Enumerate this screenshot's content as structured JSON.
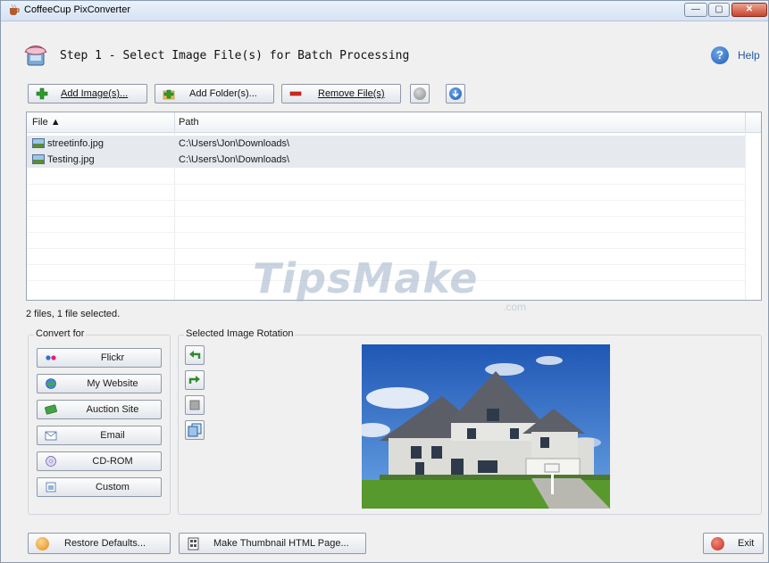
{
  "window": {
    "title": "CoffeeCup PixConverter",
    "min_glyph": "—",
    "max_glyph": "▢",
    "close_glyph": "✕"
  },
  "step": {
    "title": "Step 1 - Select Image File(s) for Batch Processing"
  },
  "help": {
    "label": "Help",
    "glyph": "?"
  },
  "toolbar": {
    "add_images": "Add Image(s)...",
    "add_folder": "Add Folder(s)...",
    "remove_files": "Remove File(s)"
  },
  "filelist": {
    "columns": [
      "File ▲",
      "Path"
    ],
    "rows": [
      {
        "file": "streetinfo.jpg",
        "path": "C:\\Users\\Jon\\Downloads\\"
      },
      {
        "file": "Testing.jpg",
        "path": "C:\\Users\\Jon\\Downloads\\"
      }
    ]
  },
  "status": "2 files, 1 file selected.",
  "watermark": {
    "main": "TipsMake",
    "suffix": ".com"
  },
  "convert_for": {
    "label": "Convert for",
    "buttons": [
      "Flickr",
      "My Website",
      "Auction Site",
      "Email",
      "CD-ROM",
      "Custom"
    ]
  },
  "rotation": {
    "label": "Selected Image Rotation"
  },
  "bottom": {
    "restore": "Restore Defaults...",
    "thumbnail": "Make Thumbnail HTML Page...",
    "exit": "Exit"
  },
  "colors": {
    "accent": "#2456a6",
    "selected_row": "#e6e9ee",
    "remove_red": "#d42a1c",
    "add_green": "#2e9a2e"
  }
}
